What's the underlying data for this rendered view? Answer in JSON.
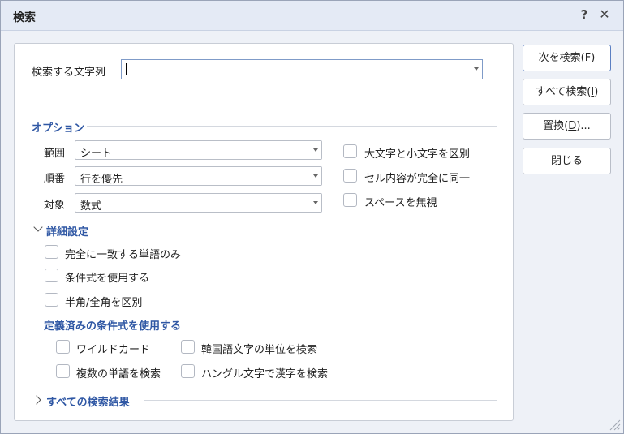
{
  "dialog": {
    "title": "検索",
    "help_label": "?",
    "close_label": "✕"
  },
  "search": {
    "label": "検索する文字列",
    "value": ""
  },
  "options": {
    "section_title": "オプション",
    "range_label": "範囲",
    "range_value": "シート",
    "order_label": "順番",
    "order_value": "行を優先",
    "target_label": "対象",
    "target_value": "数式",
    "match_case": "大文字と小文字を区別",
    "whole_cell": "セル内容が完全に同一",
    "ignore_space": "スペースを無視"
  },
  "advanced": {
    "section_title": "詳細設定",
    "whole_word": "完全に一致する単語のみ",
    "use_condition": "条件式を使用する",
    "half_full_width": "半角/全角を区別"
  },
  "predefined": {
    "section_title": "定義済みの条件式を使用する",
    "wildcard": "ワイルドカード",
    "korean_unit": "韓国語文字の単位を検索",
    "multi_word": "複数の単語を検索",
    "hangul_hanja": "ハングル文字で漢字を検索"
  },
  "results": {
    "section_title": "すべての検索結果"
  },
  "buttons": {
    "find_next_text": "次を検索(",
    "find_next_key": "F",
    "find_next_end": ")",
    "find_all_text": "すべて検索(",
    "find_all_key": "I",
    "find_all_end": ")",
    "replace_text": "置換(",
    "replace_key": "D",
    "replace_end": ")...",
    "close": "閉じる"
  }
}
